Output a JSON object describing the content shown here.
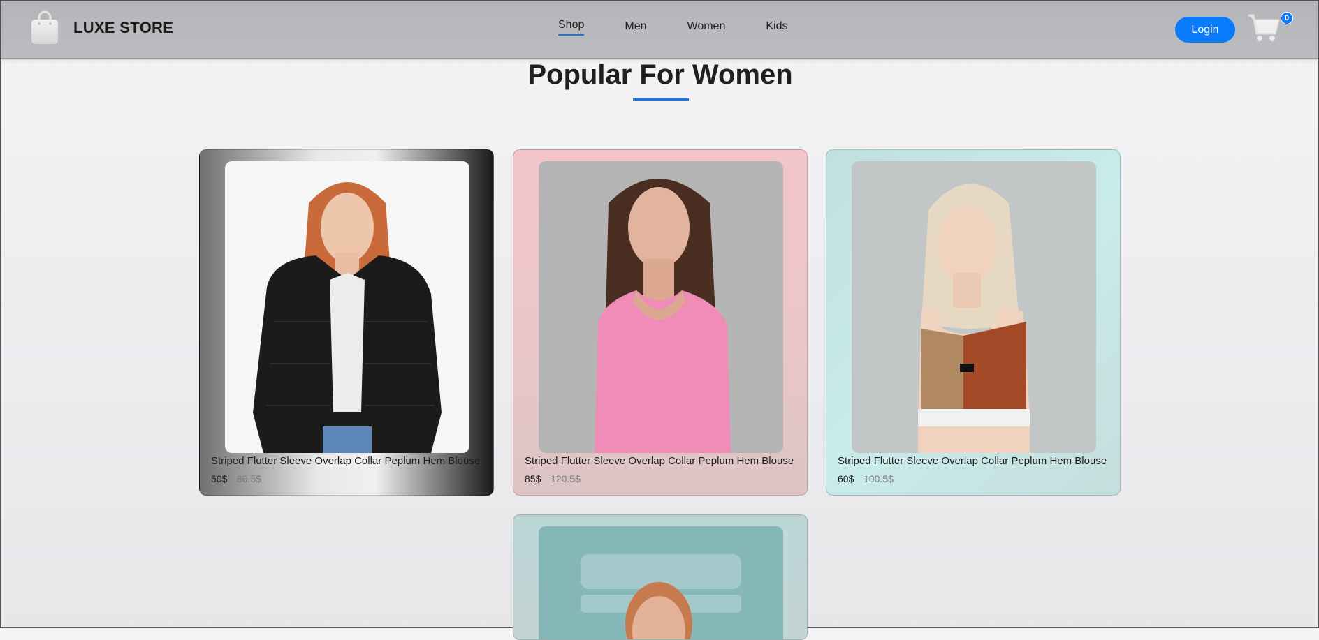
{
  "nav": {
    "brand": "LUXE STORE",
    "menu": [
      {
        "label": "Shop",
        "active": true
      },
      {
        "label": "Men",
        "active": false
      },
      {
        "label": "Women",
        "active": false
      },
      {
        "label": "Kids",
        "active": false
      }
    ],
    "login_label": "Login",
    "cart_count": "0",
    "accent_color": "#0a7bfa"
  },
  "section": {
    "title": "Popular For Women"
  },
  "products": [
    {
      "name": "Striped Flutter Sleeve Overlap Collar Peplum Hem Blouse",
      "price": "50$",
      "old_price": "80.5$",
      "image": "woman-black-fur-jacket"
    },
    {
      "name": "Striped Flutter Sleeve Overlap Collar Peplum Hem Blouse",
      "price": "85$",
      "old_price": "120.5$",
      "image": "woman-pink-top"
    },
    {
      "name": "Striped Flutter Sleeve Overlap Collar Peplum Hem Blouse",
      "price": "60$",
      "old_price": "100.5$",
      "image": "woman-sport-crop-top"
    },
    {
      "name": "",
      "price": "",
      "old_price": "",
      "image": "woman-partial-with-watermark"
    }
  ]
}
